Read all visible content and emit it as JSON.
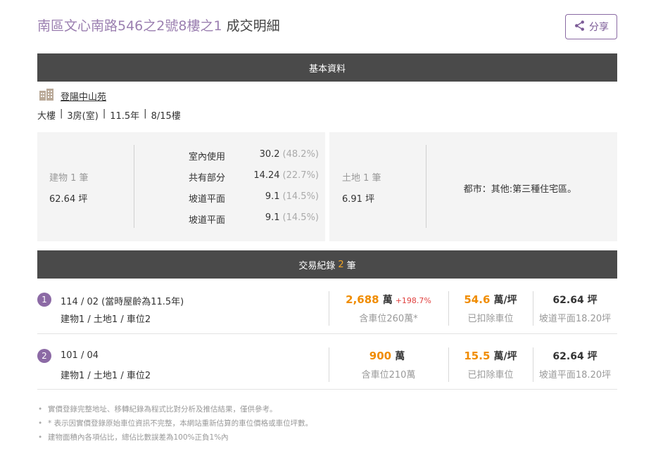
{
  "header": {
    "address": "南區文心南路546之2號8樓之1",
    "suffix": "成交明細",
    "share_label": "分享"
  },
  "sections": {
    "basic_title": "基本資料",
    "tx_title_prefix": "交易紀錄",
    "tx_count": "2",
    "tx_title_suffix": "筆"
  },
  "community": {
    "name": "登陽中山苑",
    "icon": "building-icon"
  },
  "specs": [
    "大樓",
    "3房(室)",
    "11.5年",
    "8/15樓"
  ],
  "building": {
    "label": "建物 1 筆",
    "area": "62.64 坪",
    "rows": [
      {
        "name": "室內使用",
        "value": "30.2",
        "pct": "(48.2%)"
      },
      {
        "name": "共有部分",
        "value": "14.24",
        "pct": "(22.7%)"
      },
      {
        "name": "坡道平面",
        "value": "9.1",
        "pct": "(14.5%)"
      },
      {
        "name": "坡道平面",
        "value": "9.1",
        "pct": "(14.5%)"
      }
    ]
  },
  "land": {
    "label": "土地 1 筆",
    "area": "6.91 坪",
    "zone": "都市：其他:第三種住宅區。"
  },
  "transactions": [
    {
      "index": "1",
      "date": "114 / 02 (當時屋齡為11.5年)",
      "kinds": "建物1 / 土地1 / 車位2",
      "price": "2,688",
      "price_unit": "萬",
      "change": "+198.7%",
      "price_note": "含車位260萬*",
      "unit_price": "54.6",
      "unit_price_unit": "萬/坪",
      "unit_note": "已扣除車位",
      "area": "62.64 坪",
      "area_note": "坡道平面18.20坪"
    },
    {
      "index": "2",
      "date": "101 / 04",
      "kinds": "建物1 / 土地1 / 車位2",
      "price": "900",
      "price_unit": "萬",
      "change": "",
      "price_note": "含車位210萬",
      "unit_price": "15.5",
      "unit_price_unit": "萬/坪",
      "unit_note": "已扣除車位",
      "area": "62.64 坪",
      "area_note": "坡道平面18.20坪"
    }
  ],
  "notes": [
    "實價登錄完整地址、移轉紀錄為程式比對分析及推估結果，僅供參考。",
    "* 表示因實價登錄原始車位資訊不完整，本網站重新估算的車位價格或車位坪數。",
    "建物面積內各項佔比，總佔比數誤差為100%正負1%內"
  ],
  "colors": {
    "accent_purple": "#8c6aa5",
    "price_orange": "#f08c00",
    "change_red": "#e0413f",
    "bar_dark": "#4a4a4a"
  }
}
